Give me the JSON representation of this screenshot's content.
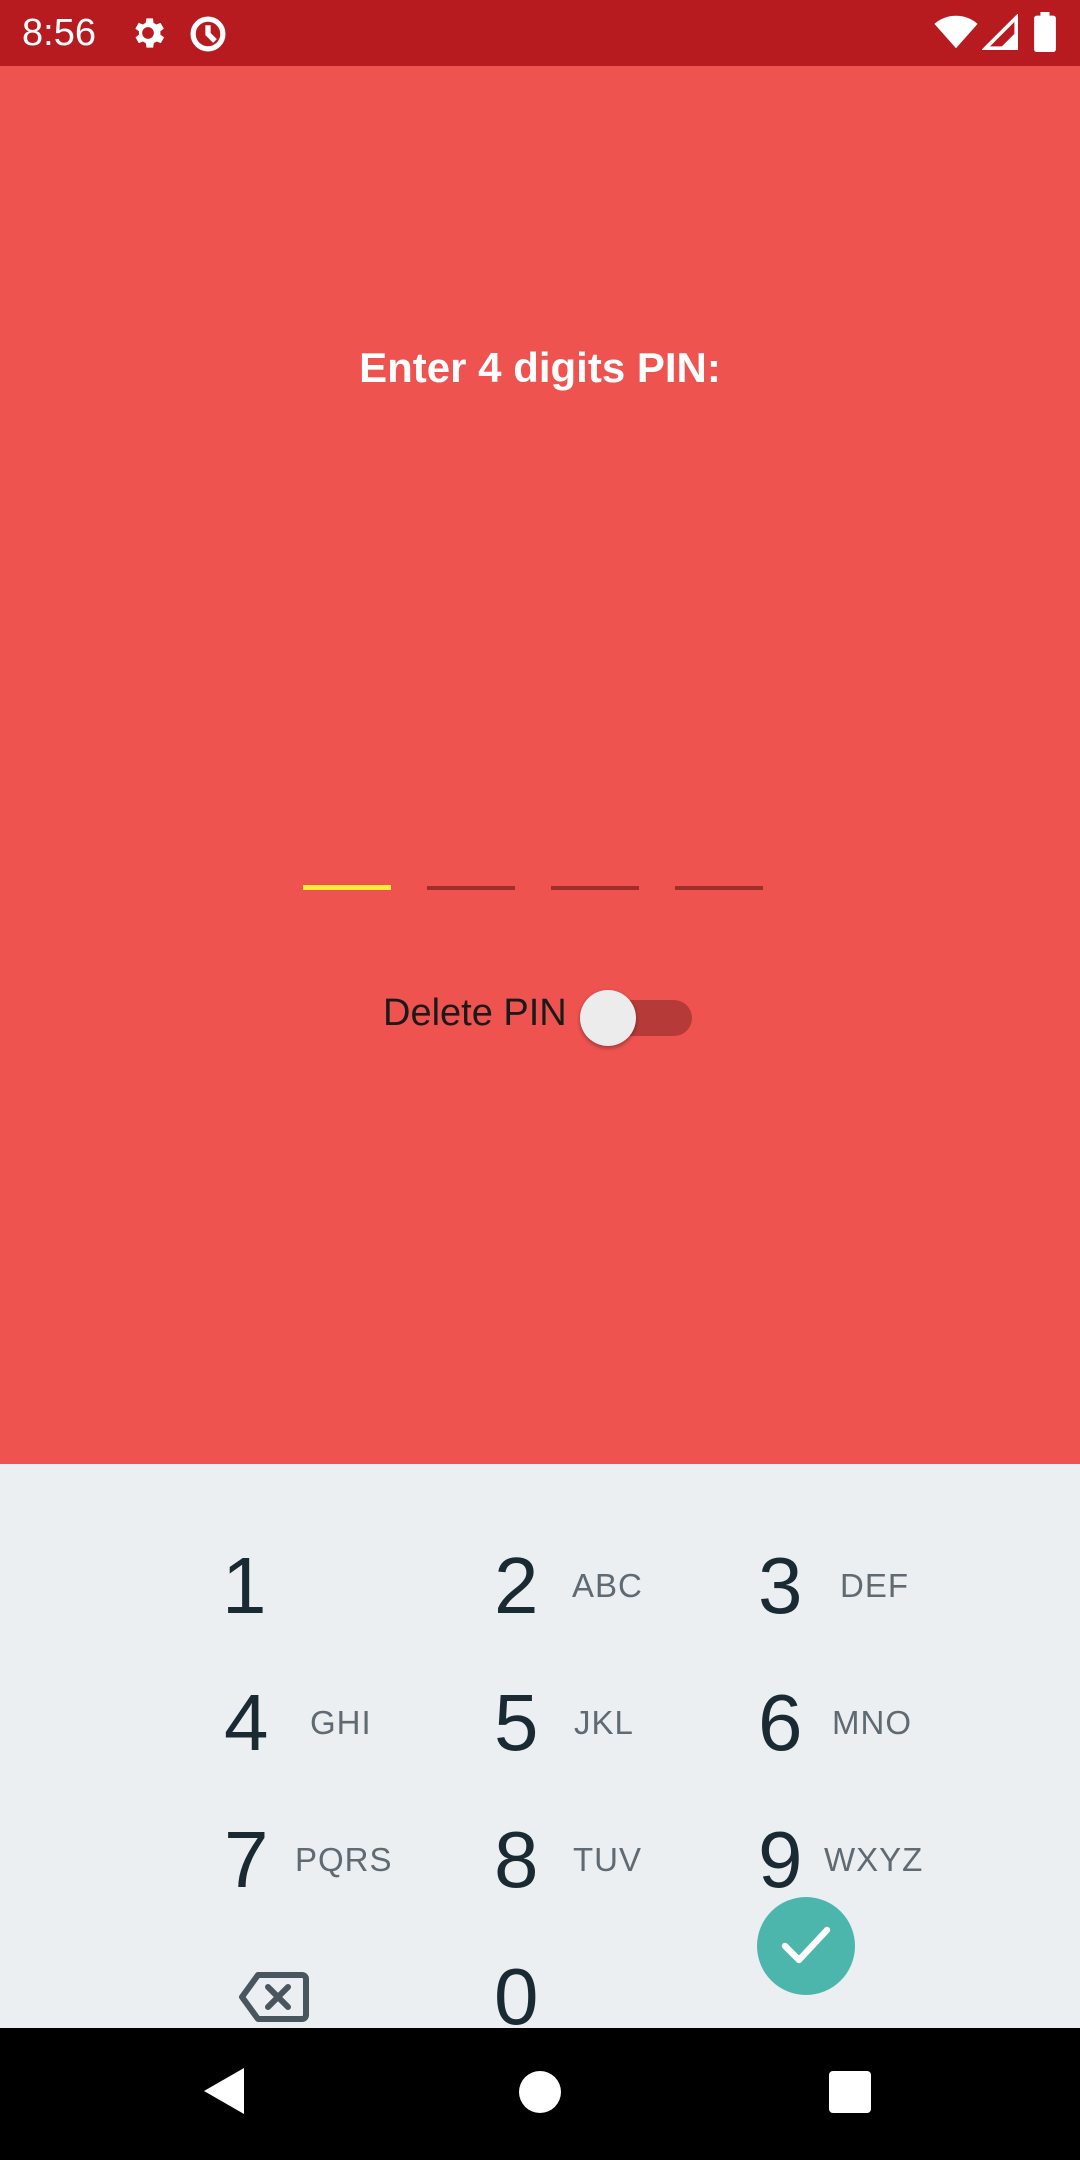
{
  "status_bar": {
    "time": "8:56",
    "icons": [
      "gear-icon",
      "data-saver-icon",
      "wifi-icon",
      "cellular-signal-icon",
      "battery-icon"
    ],
    "background": "#b71a1f"
  },
  "pin_screen": {
    "prompt": "Enter 4 digits PIN:",
    "pin_length": 4,
    "entered_digits": 0,
    "active_slot_color": "#ffeb3b",
    "background": "#ef5350",
    "delete_pin": {
      "label": "Delete PIN",
      "enabled": false
    }
  },
  "keypad": {
    "keys": [
      {
        "digit": "1",
        "letters": ""
      },
      {
        "digit": "2",
        "letters": "ABC"
      },
      {
        "digit": "3",
        "letters": "DEF"
      },
      {
        "digit": "4",
        "letters": "GHI"
      },
      {
        "digit": "5",
        "letters": "JKL"
      },
      {
        "digit": "6",
        "letters": "MNO"
      },
      {
        "digit": "7",
        "letters": "PQRS"
      },
      {
        "digit": "8",
        "letters": "TUV"
      },
      {
        "digit": "9",
        "letters": "WXYZ"
      },
      {
        "digit": "0",
        "letters": ""
      }
    ],
    "backspace_icon": "backspace-icon",
    "confirm_icon": "check-icon",
    "confirm_color": "#4db6ac",
    "background": "#eceff1"
  },
  "nav_bar": {
    "buttons": [
      "back-icon",
      "home-icon",
      "recents-icon"
    ]
  }
}
